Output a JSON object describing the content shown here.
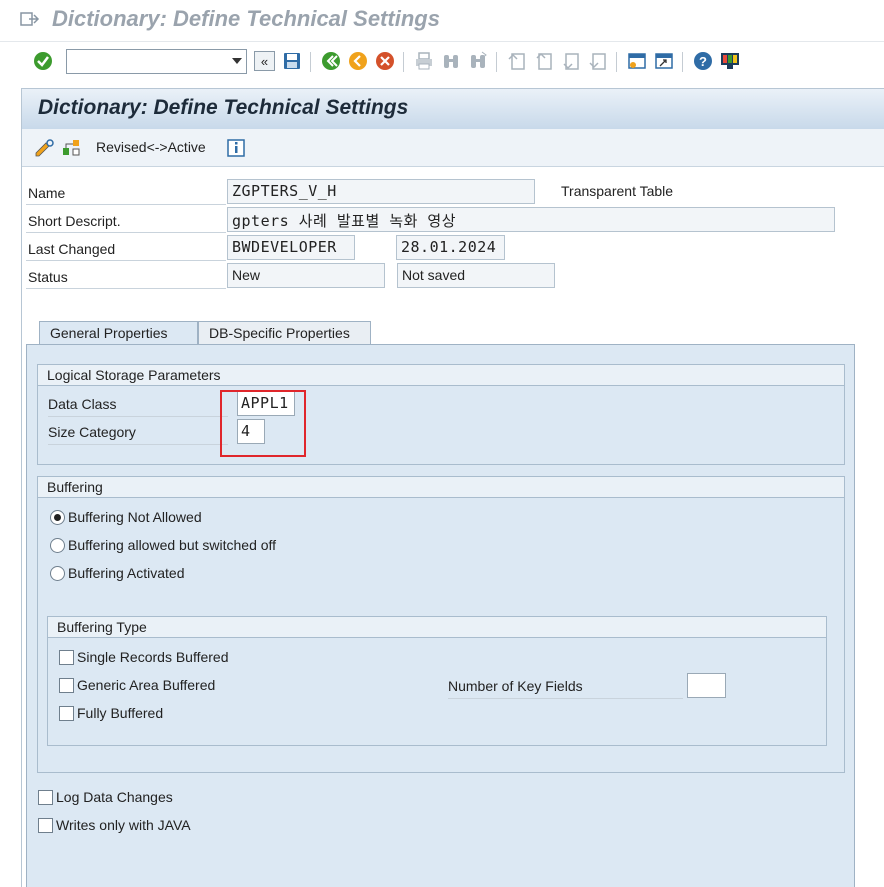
{
  "window": {
    "title": "Dictionary: Define Technical Settings"
  },
  "toolbar": {
    "command_value": ""
  },
  "screen": {
    "title": "Dictionary: Define Technical Settings",
    "app_toolbar": {
      "revised_active_label": "Revised<->Active"
    }
  },
  "form": {
    "name_label": "Name",
    "name_value": "ZGPTERS_V_H",
    "table_type": "Transparent Table",
    "short_desc_label": "Short Descript.",
    "short_desc_value": "gpters 사례 발표별 녹화 영상",
    "last_changed_label": "Last Changed",
    "last_changed_user": "BWDEVELOPER",
    "last_changed_date": "28.01.2024",
    "status_label": "Status",
    "status_value": "New",
    "save_state": "Not saved"
  },
  "tabs": [
    {
      "label": "General Properties",
      "active": true
    },
    {
      "label": "DB-Specific Properties",
      "active": false
    }
  ],
  "logical_storage": {
    "title": "Logical Storage Parameters",
    "data_class_label": "Data Class",
    "data_class_value": "APPL1",
    "size_category_label": "Size Category",
    "size_category_value": "4"
  },
  "buffering": {
    "title": "Buffering",
    "options": [
      {
        "label": "Buffering Not Allowed",
        "selected": true
      },
      {
        "label": "Buffering allowed but switched off",
        "selected": false
      },
      {
        "label": "Buffering Activated",
        "selected": false
      }
    ]
  },
  "buffering_type": {
    "title": "Buffering Type",
    "options": [
      {
        "label": "Single Records Buffered",
        "checked": false
      },
      {
        "label": "Generic Area Buffered",
        "checked": false
      },
      {
        "label": "Fully Buffered",
        "checked": false
      }
    ],
    "key_fields_label": "Number of Key Fields",
    "key_fields_value": ""
  },
  "bottom_options": [
    {
      "label": "Log Data Changes",
      "checked": false
    },
    {
      "label": "Writes only with JAVA",
      "checked": false
    }
  ],
  "colors": {
    "highlight": "#e0262b",
    "panel_bg": "#dce8f3",
    "title_gray": "#9aa3ad"
  }
}
